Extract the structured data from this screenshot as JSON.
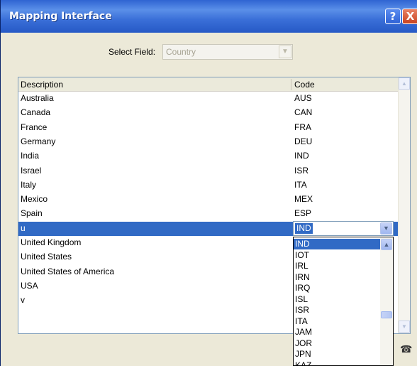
{
  "window": {
    "title": "Mapping Interface",
    "help_label": "?",
    "close_label": "X"
  },
  "select_field": {
    "label": "Select Field:",
    "value": "Country"
  },
  "grid": {
    "columns": [
      "Description",
      "Code"
    ],
    "rows": [
      {
        "description": "Australia",
        "code": "AUS"
      },
      {
        "description": "Canada",
        "code": "CAN"
      },
      {
        "description": "France",
        "code": "FRA"
      },
      {
        "description": "Germany",
        "code": "DEU"
      },
      {
        "description": "India",
        "code": "IND"
      },
      {
        "description": "Israel",
        "code": "ISR"
      },
      {
        "description": "Italy",
        "code": "ITA"
      },
      {
        "description": "Mexico",
        "code": "MEX"
      },
      {
        "description": "Spain",
        "code": "ESP"
      },
      {
        "description": "u",
        "code": ""
      },
      {
        "description": "United Kingdom",
        "code": ""
      },
      {
        "description": "United States",
        "code": ""
      },
      {
        "description": "United States of America",
        "code": ""
      },
      {
        "description": "USA",
        "code": ""
      },
      {
        "description": "v",
        "code": ""
      }
    ],
    "selected_row_index": 9
  },
  "code_editor": {
    "value": "IND",
    "options": [
      "IND",
      "IOT",
      "IRL",
      "IRN",
      "IRQ",
      "ISL",
      "ISR",
      "ITA",
      "JAM",
      "JOR",
      "JPN",
      "KAZ"
    ],
    "highlighted": "IND"
  },
  "icons": {
    "dropdown_arrow": "chevron-down-icon",
    "scroll_up": "chevron-up-icon",
    "scroll_down": "chevron-down-icon",
    "corner": "phone-icon"
  },
  "colors": {
    "title_bar": "#2f64d2",
    "selection": "#316ac5",
    "window_bg": "#ece9d8"
  }
}
